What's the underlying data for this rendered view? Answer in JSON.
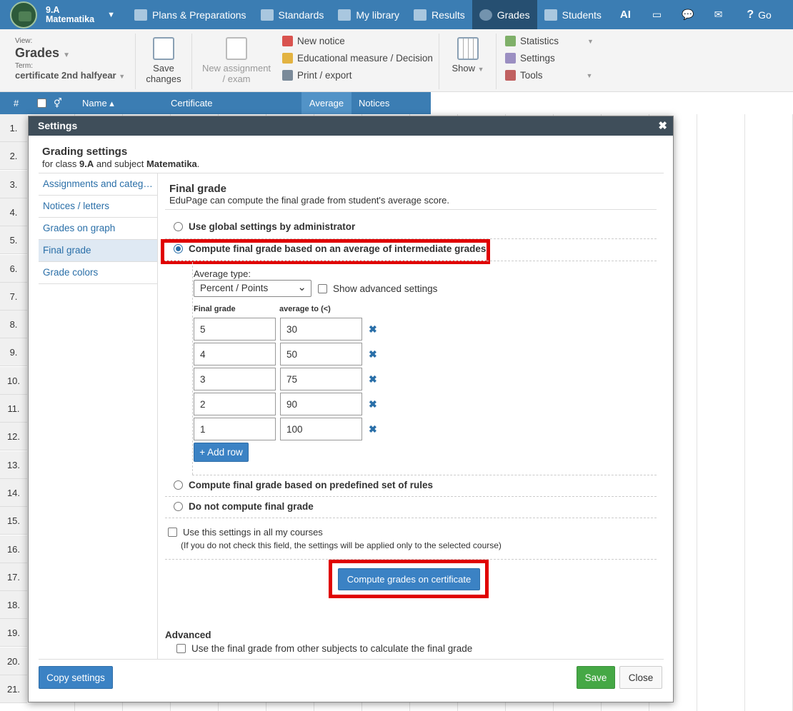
{
  "nav": {
    "class_name": "9.A",
    "subject": "Matematika",
    "items": [
      {
        "label": "Plans & Preparations",
        "icon": "briefcase-icon"
      },
      {
        "label": "Standards",
        "icon": "shield-icon"
      },
      {
        "label": "My library",
        "icon": "library-icon"
      },
      {
        "label": "Results",
        "icon": "bar-chart-icon"
      },
      {
        "label": "Grades",
        "icon": "grades-icon",
        "active": true
      },
      {
        "label": "Students",
        "icon": "students-icon"
      },
      {
        "label": "AI",
        "icon": "ai-icon"
      }
    ],
    "overflow": "Go"
  },
  "toolbar": {
    "view_label": "View:",
    "view_value": "Grades",
    "term_label": "Term:",
    "term_value": "certificate 2nd halfyear",
    "save_line1": "Save",
    "save_line2": "changes",
    "newassign_line1": "New assignment",
    "newassign_line2": "/ exam",
    "new_notice": "New notice",
    "edu_measure": "Educational measure / Decision",
    "print_export": "Print / export",
    "show": "Show",
    "statistics": "Statistics",
    "settings": "Settings",
    "tools": "Tools"
  },
  "grid": {
    "col_hash": "#",
    "col_name": "Name ▴",
    "col_certificate": "Certificate",
    "col_average": "Average",
    "col_notices": "Notices",
    "rows": [
      "1.",
      "2.",
      "3.",
      "4.",
      "5.",
      "6.",
      "7.",
      "8.",
      "9.",
      "10.",
      "11.",
      "12.",
      "13.",
      "14.",
      "15.",
      "16.",
      "17.",
      "18.",
      "19.",
      "20.",
      "21."
    ]
  },
  "modal": {
    "title": "Settings",
    "heading": "Grading settings",
    "sub_prefix": "for class ",
    "sub_class": "9.A",
    "sub_mid": " and subject ",
    "sub_subject": "Matematika",
    "sub_end": ".",
    "sidebar": [
      "Assignments and categ…",
      "Notices / letters",
      "Grades on graph",
      "Final grade",
      "Grade colors"
    ],
    "section_title": "Final grade",
    "section_desc": "EduPage can compute the final grade from student's average score.",
    "opt_global": "Use global settings by administrator",
    "opt_average": "Compute final grade based on an average of intermediate grades",
    "avg_type_label": "Average type:",
    "avg_type_value": "Percent / Points",
    "show_advanced": "Show advanced settings",
    "th_final": "Final grade",
    "th_avg": "average to (<)",
    "grade_rows": [
      {
        "grade": "5",
        "avg": "30"
      },
      {
        "grade": "4",
        "avg": "50"
      },
      {
        "grade": "3",
        "avg": "75"
      },
      {
        "grade": "2",
        "avg": "90"
      },
      {
        "grade": "1",
        "avg": "100"
      }
    ],
    "add_row": "+ Add row",
    "opt_rules": "Compute final grade based on predefined set of rules",
    "opt_none": "Do not compute final grade",
    "use_all": "Use this settings in all my courses",
    "use_all_note": "(If you do not check this field, the settings will be applied only to the selected course)",
    "compute_btn": "Compute grades on certificate",
    "advanced_title": "Advanced",
    "advanced_opt": "Use the final grade from other subjects to calculate the final grade",
    "copy_btn": "Copy settings",
    "save_btn": "Save",
    "close_btn": "Close"
  },
  "colors": {
    "nav": "#3b7db3",
    "highlight": "#e00000",
    "save": "#45a845"
  }
}
